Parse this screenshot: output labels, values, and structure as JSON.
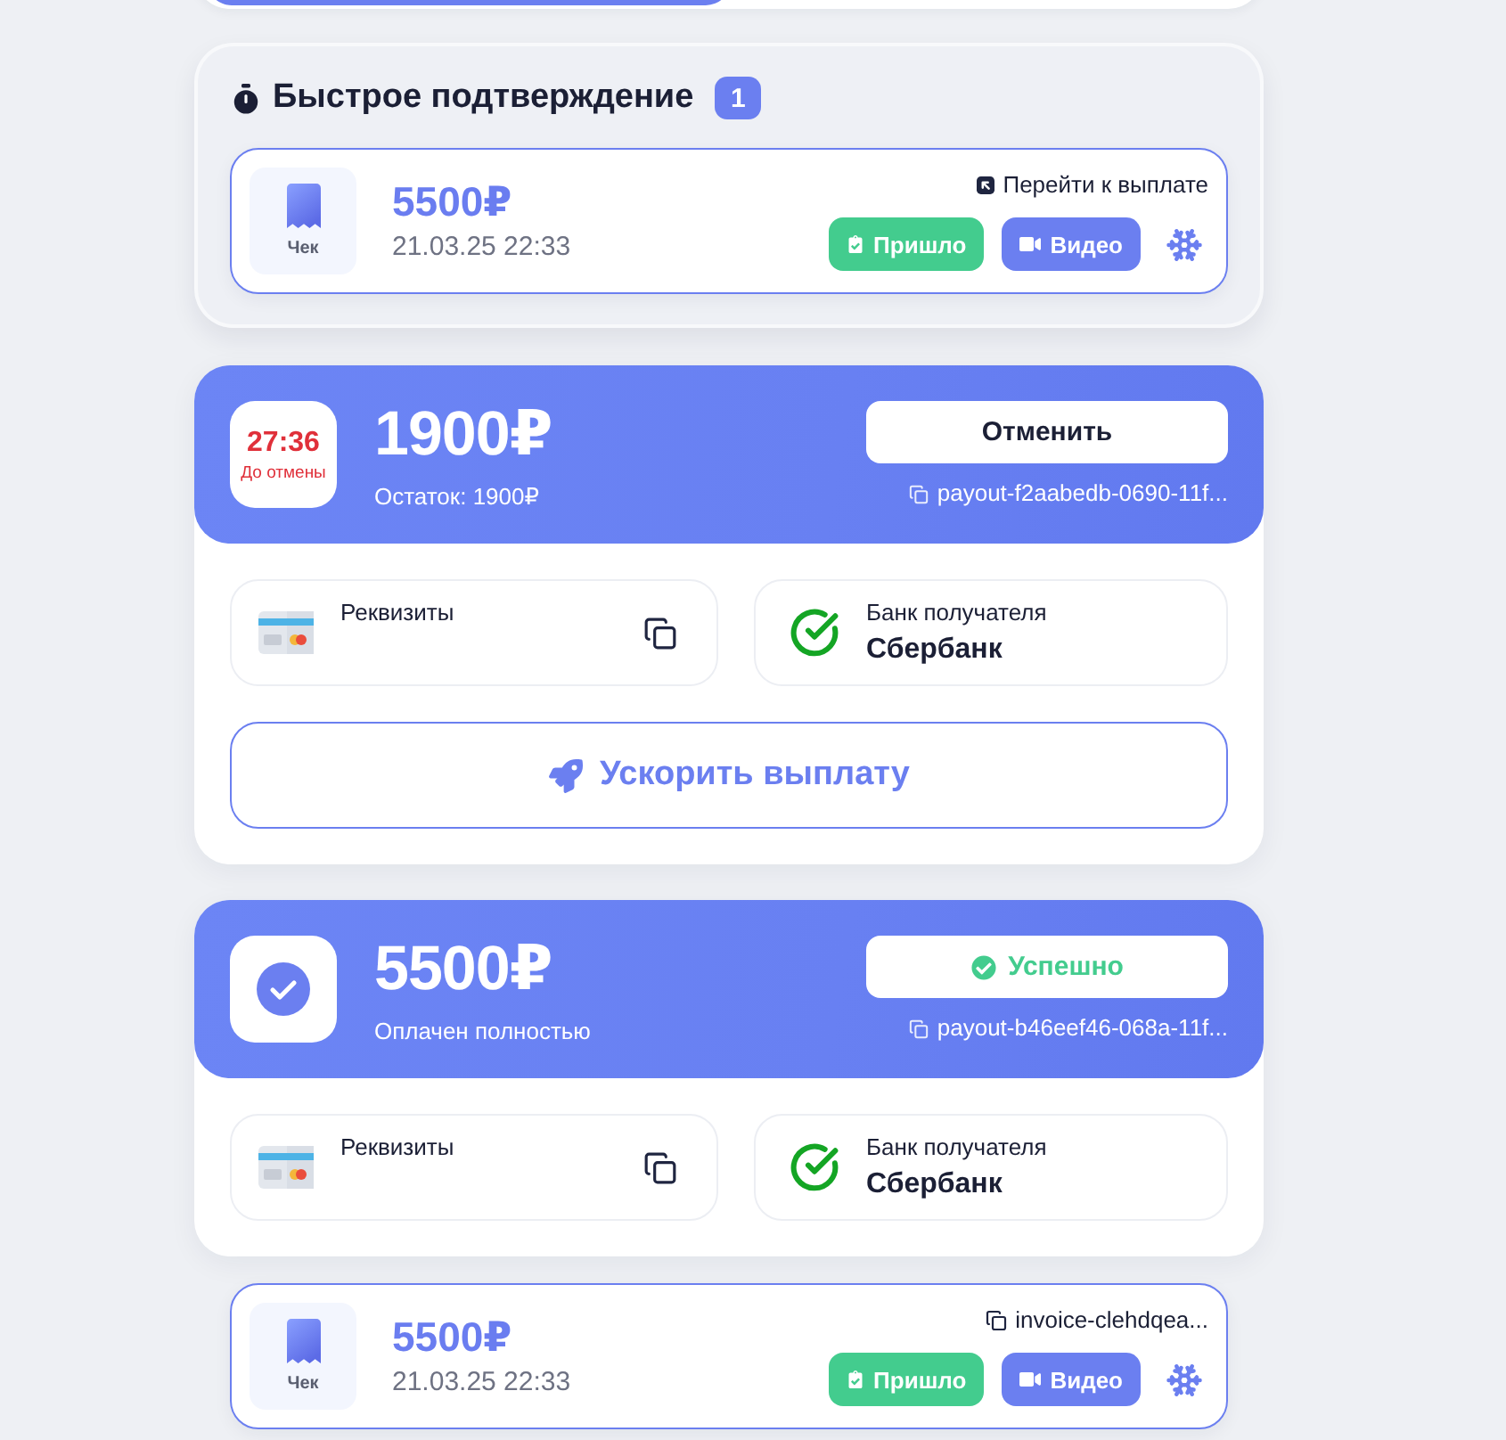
{
  "segmented_control": {
    "segments": [
      {
        "selected": true
      },
      {
        "selected": false
      }
    ]
  },
  "quick_confirm": {
    "title": "Быстрое подтверждение",
    "count": "1",
    "items": [
      {
        "receipt_label": "Чек",
        "amount": "5500₽",
        "date": "21.03.25 22:33",
        "meta": {
          "kind": "link",
          "text": "Перейти к выплате"
        },
        "buttons": [
          {
            "kind": "arrived",
            "label": "Пришло"
          },
          {
            "kind": "video",
            "label": "Видео"
          }
        ]
      }
    ]
  },
  "payouts": [
    {
      "badge": {
        "kind": "timer",
        "time": "27:36",
        "label": "До отмены"
      },
      "amount": "1900₽",
      "subtitle": "Остаток: 1900₽",
      "action": {
        "kind": "cancel",
        "label": "Отменить"
      },
      "payout_id": "payout-f2aabedb-0690-11f...",
      "details": [
        {
          "kind": "requisites",
          "label": "Реквизиты"
        },
        {
          "kind": "bank",
          "label": "Банк получателя",
          "value": "Сбербанк"
        }
      ],
      "speedup_button": "Ускорить выплату"
    },
    {
      "badge": {
        "kind": "done"
      },
      "amount": "5500₽",
      "subtitle": "Оплачен полностью",
      "action": {
        "kind": "success",
        "label": "Успешно"
      },
      "payout_id": "payout-b46eef46-068a-11f...",
      "details": [
        {
          "kind": "requisites",
          "label": "Реквизиты"
        },
        {
          "kind": "bank",
          "label": "Банк получателя",
          "value": "Сбербанк"
        }
      ]
    }
  ],
  "receipts": [
    {
      "receipt_label": "Чек",
      "amount": "5500₽",
      "date": "21.03.25 22:33",
      "meta": {
        "kind": "copy",
        "text": "invoice-clehdqea..."
      },
      "buttons": [
        {
          "kind": "arrived",
          "label": "Пришло"
        },
        {
          "kind": "video",
          "label": "Видео"
        }
      ]
    }
  ]
}
